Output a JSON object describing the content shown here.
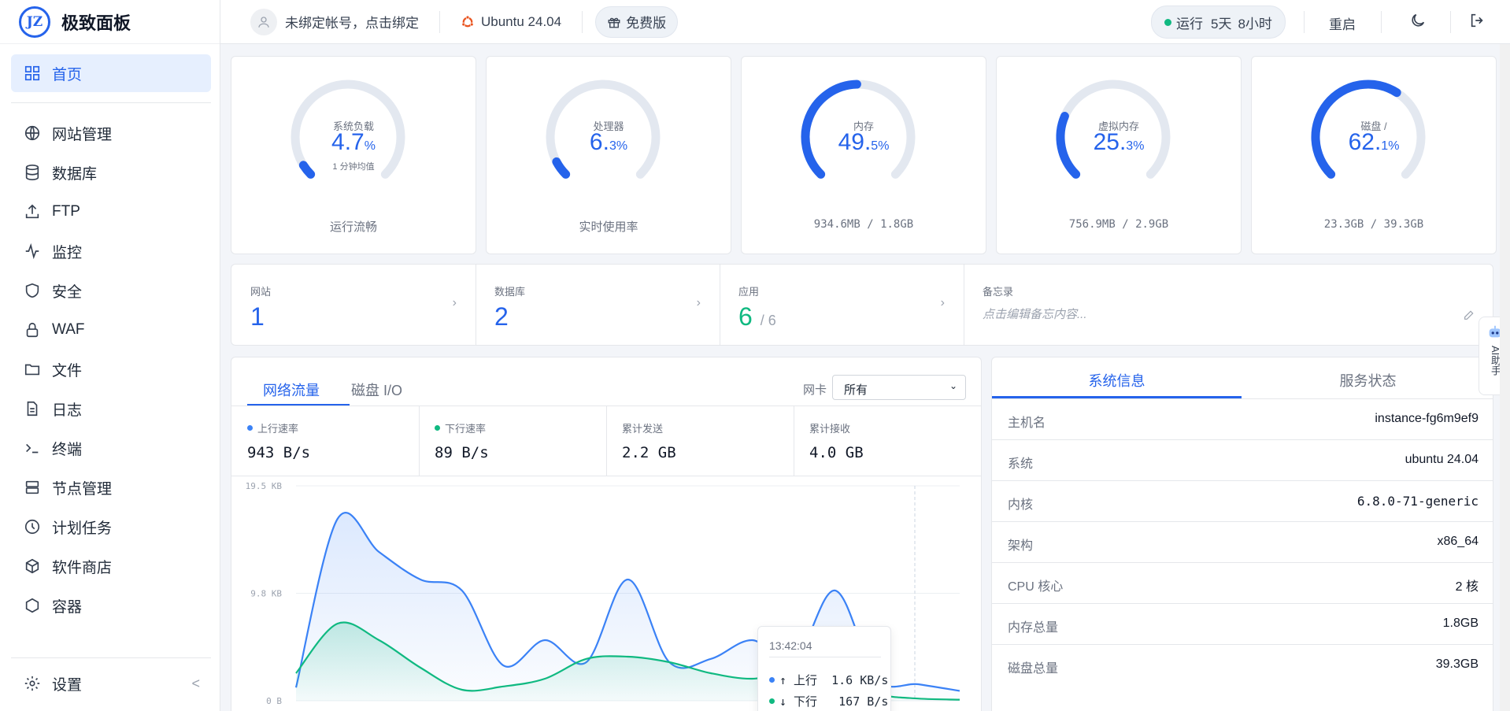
{
  "app": {
    "logo_text": "JZ",
    "name": "极致面板"
  },
  "nav": {
    "items": [
      {
        "label": "首页",
        "icon": "grid-icon"
      },
      {
        "label": "网站管理",
        "icon": "globe-icon"
      },
      {
        "label": "数据库",
        "icon": "database-icon"
      },
      {
        "label": "FTP",
        "icon": "upload-icon"
      },
      {
        "label": "监控",
        "icon": "activity-icon"
      },
      {
        "label": "安全",
        "icon": "shield-icon"
      },
      {
        "label": "WAF",
        "icon": "lock-icon"
      },
      {
        "label": "文件",
        "icon": "folder-icon"
      },
      {
        "label": "日志",
        "icon": "file-icon"
      },
      {
        "label": "终端",
        "icon": "terminal-icon"
      },
      {
        "label": "节点管理",
        "icon": "server-icon"
      },
      {
        "label": "计划任务",
        "icon": "clock-icon"
      },
      {
        "label": "软件商店",
        "icon": "package-icon"
      },
      {
        "label": "容器",
        "icon": "hexagon-icon"
      }
    ],
    "settings_label": "设置",
    "collapse_glyph": "<"
  },
  "header": {
    "account": "未绑定帐号，点击绑定",
    "os": "Ubuntu 24.04",
    "edition": "免费版",
    "uptime_prefix": "运行",
    "uptime_days": "5天",
    "uptime_hours": "8小时",
    "restart": "重启"
  },
  "gauges": [
    {
      "label": "系统负载",
      "int": "4.7",
      "unit": "%",
      "sub": "1 分钟均值",
      "footer": "运行流畅",
      "percent": 4.7
    },
    {
      "label": "处理器",
      "int": "6.",
      "unit": "3%",
      "sub": "",
      "footer": "实时使用率",
      "percent": 6.3
    },
    {
      "label": "内存",
      "int": "49.",
      "unit": "5%",
      "sub": "",
      "footer": "934.6MB / 1.8GB",
      "percent": 49.5
    },
    {
      "label": "虚拟内存",
      "int": "25.",
      "unit": "3%",
      "sub": "",
      "footer": "756.9MB / 2.9GB",
      "percent": 25.3
    },
    {
      "label": "磁盘 /",
      "int": "62.",
      "unit": "1%",
      "sub": "",
      "footer": "23.3GB / 39.3GB",
      "percent": 62.1
    }
  ],
  "stats": {
    "sites_label": "网站",
    "sites": "1",
    "db_label": "数据库",
    "db": "2",
    "apps_label": "应用",
    "apps": "6",
    "apps_total": "/ 6",
    "memo_label": "备忘录",
    "memo_placeholder": "点击编辑备忘内容..."
  },
  "traffic": {
    "tab_network": "网络流量",
    "tab_disk": "磁盘 I/O",
    "nic_label": "网卡",
    "nic_value": "所有",
    "up_label": "上行速率",
    "up_value": "943 B/s",
    "down_label": "下行速率",
    "down_value": "89 B/s",
    "sent_label": "累计发送",
    "sent_value": "2.2 GB",
    "recv_label": "累计接收",
    "recv_value": "4.0 GB",
    "up_color": "#3b82f6",
    "down_color": "#10b981",
    "tooltip": {
      "time": "13:42:04",
      "up": "↑ 上行  1.6 KB/s",
      "down": "↓ 下行   167 B/s"
    }
  },
  "chart_data": {
    "type": "area",
    "ylim": [
      0,
      19.5
    ],
    "yticks": [
      "19.5 KB",
      "9.8 KB",
      "0 B"
    ],
    "series": [
      {
        "name": "上行",
        "values": [
          1.2,
          16.5,
          13.5,
          11.0,
          10.0,
          3.2,
          5.5,
          3.5,
          11.0,
          3.5,
          3.8,
          5.5,
          3.5,
          10.0,
          2.0,
          1.5,
          0.9
        ]
      },
      {
        "name": "下行",
        "values": [
          2.5,
          7.0,
          5.5,
          3.0,
          1.0,
          1.3,
          2.0,
          3.8,
          4.0,
          3.5,
          2.5,
          2.0,
          2.6,
          2.0,
          0.6,
          0.2,
          0.1
        ]
      }
    ]
  },
  "sysinfo": {
    "tab_info": "系统信息",
    "tab_services": "服务状态",
    "rows": [
      {
        "k": "主机名",
        "v": "instance-fg6m9ef9"
      },
      {
        "k": "系统",
        "v": "ubuntu 24.04"
      },
      {
        "k": "内核",
        "v": "6.8.0-71-generic"
      },
      {
        "k": "架构",
        "v": "x86_64"
      },
      {
        "k": "CPU 核心",
        "v": "2 核"
      },
      {
        "k": "内存总量",
        "v": "1.8GB"
      },
      {
        "k": "磁盘总量",
        "v": "39.3GB"
      }
    ]
  },
  "ai": {
    "label": "AI助手"
  }
}
